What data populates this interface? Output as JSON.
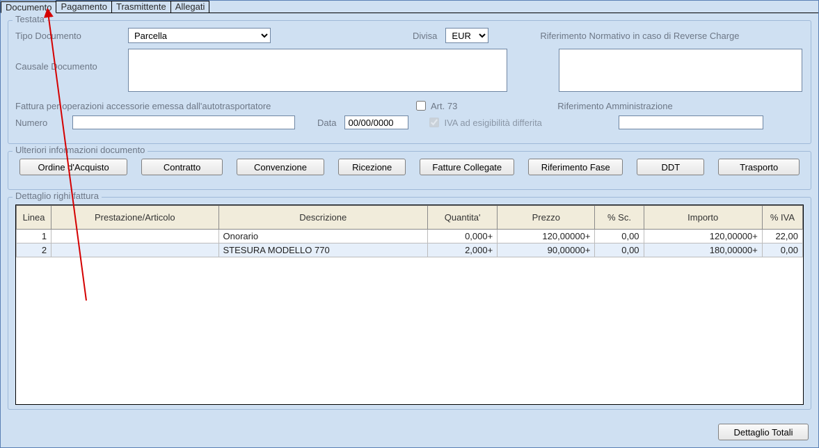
{
  "tabs": {
    "documento": "Documento",
    "pagamento": "Pagamento",
    "trasmittente": "Trasmittente",
    "allegati": "Allegati"
  },
  "testata": {
    "legend": "Testata",
    "tipo_documento_label": "Tipo Documento",
    "tipo_documento_value": "Parcella",
    "divisa_label": "Divisa",
    "divisa_value": "EUR",
    "riferimento_normativo_label": "Riferimento Normativo in caso di Reverse Charge",
    "causale_label": "Causale Documento",
    "causale_value": "",
    "riferimento_normativo_value": "",
    "fattura_accessorie_label": "Fattura per operazioni accessorie emessa dall'autotrasportatore",
    "numero_label": "Numero",
    "numero_value": "",
    "data_label": "Data",
    "data_value": "00/00/0000",
    "art73_label": "Art. 73",
    "art73_checked": false,
    "iva_diff_label": "IVA ad esigibilità differita",
    "iva_diff_checked": true,
    "rif_amm_label": "Riferimento Amministrazione",
    "rif_amm_value": ""
  },
  "ulteriori": {
    "legend": "Ulteriori informazioni documento",
    "buttons": {
      "ordine": "Ordine d'Acquisto",
      "contratto": "Contratto",
      "convenzione": "Convenzione",
      "ricezione": "Ricezione",
      "fatture_collegate": "Fatture Collegate",
      "riferimento_fase": "Riferimento Fase",
      "ddt": "DDT",
      "trasporto": "Trasporto"
    }
  },
  "dettaglio": {
    "legend": "Dettaglio righi fattura",
    "columns": {
      "linea": "Linea",
      "prestazione": "Prestazione/Articolo",
      "descrizione": "Descrizione",
      "quantita": "Quantita'",
      "prezzo": "Prezzo",
      "sc": "% Sc.",
      "importo": "Importo",
      "iva": "% IVA"
    },
    "rows": [
      {
        "linea": "1",
        "prestazione": "",
        "descrizione": "Onorario",
        "quantita": "0,000+",
        "prezzo": "120,00000+",
        "sc": "0,00",
        "importo": "120,00000+",
        "iva": "22,00"
      },
      {
        "linea": "2",
        "prestazione": "",
        "descrizione": "STESURA MODELLO 770",
        "quantita": "2,000+",
        "prezzo": "90,00000+",
        "sc": "0,00",
        "importo": "180,00000+",
        "iva": "0,00"
      }
    ]
  },
  "footer": {
    "dettaglio_totali": "Dettaglio Totali"
  }
}
